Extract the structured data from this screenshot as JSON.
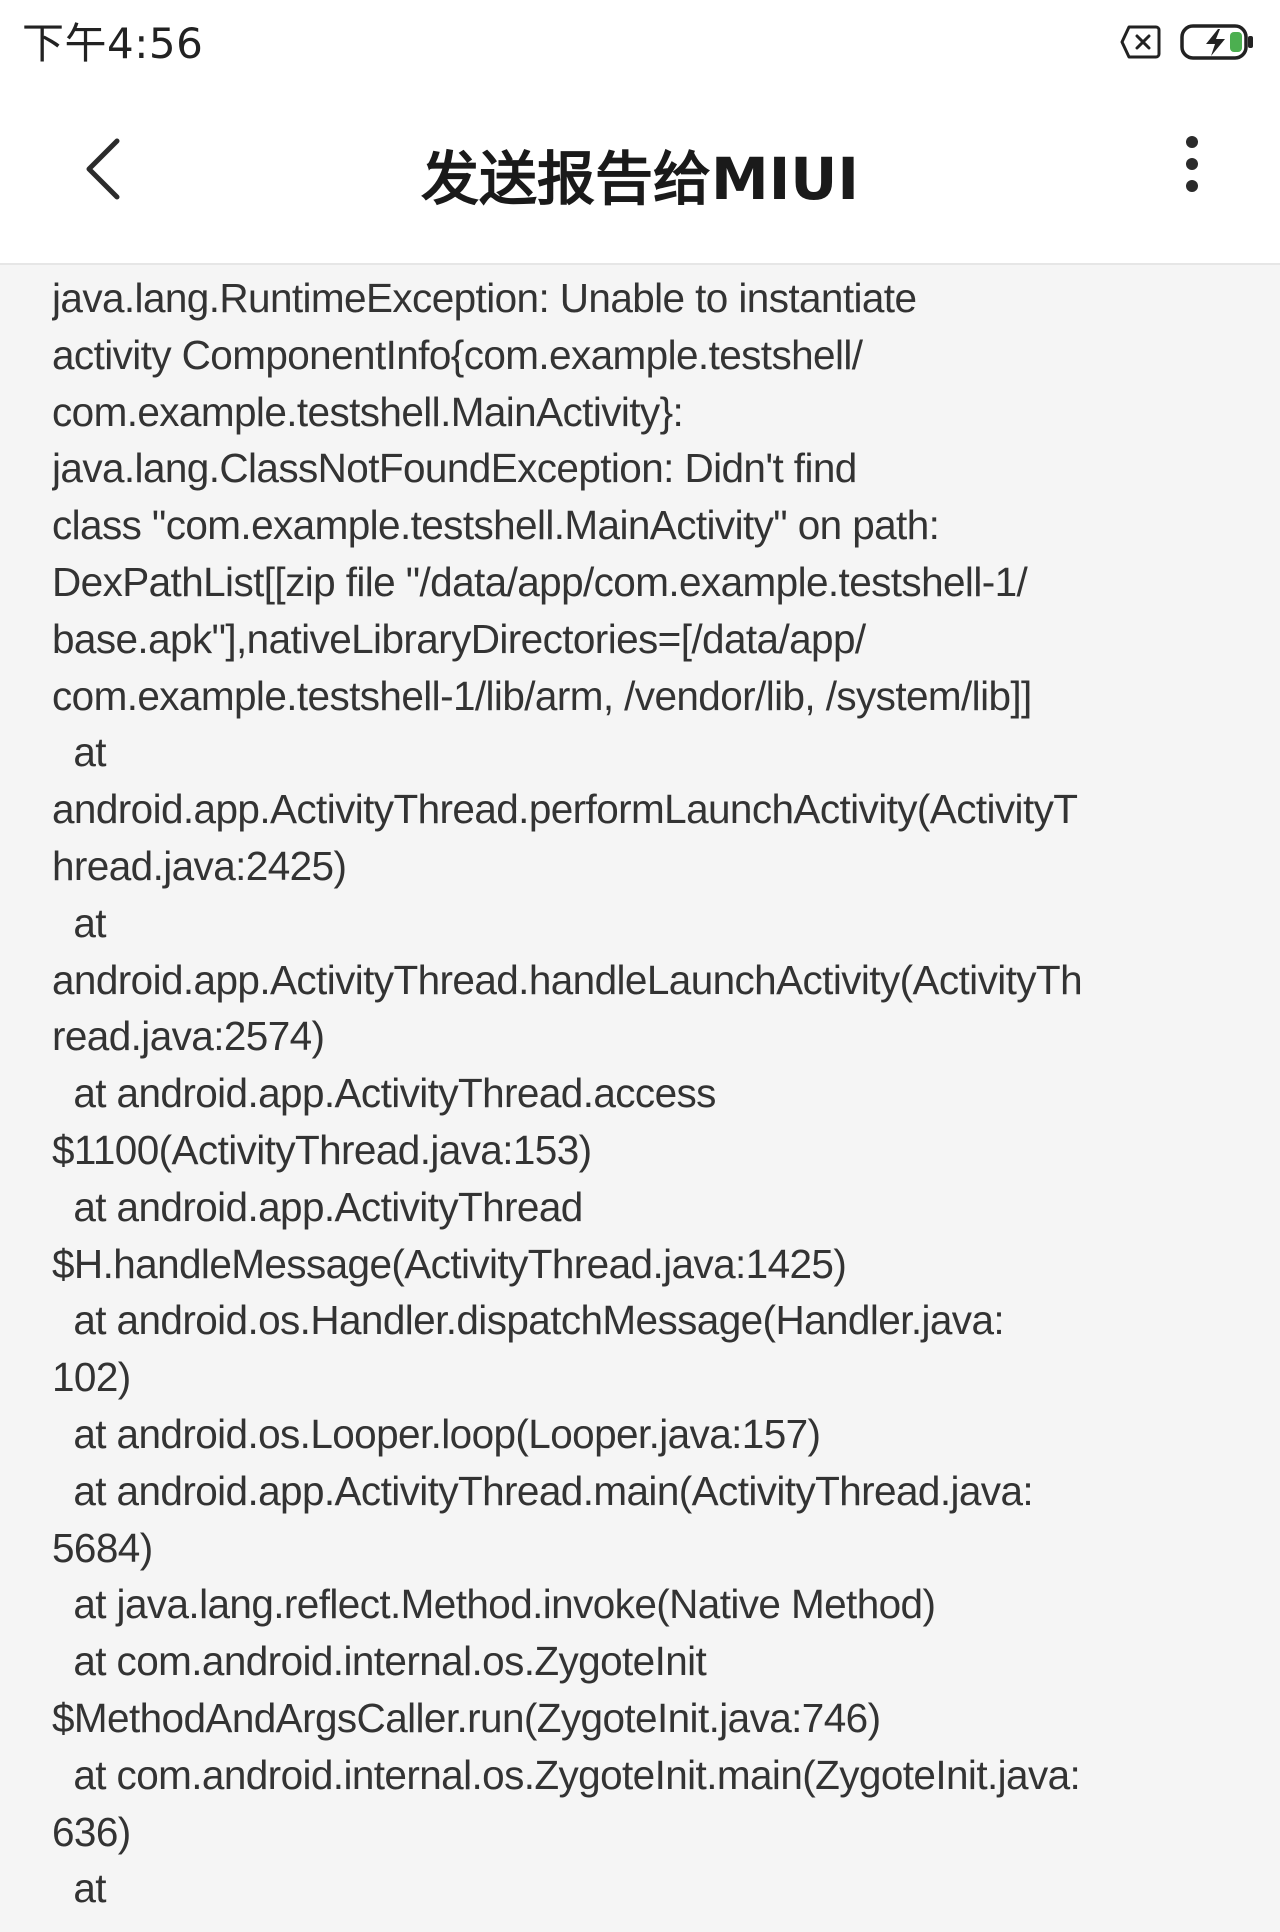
{
  "status_bar": {
    "time": "下午4:56",
    "icons": [
      "sim-card-off-icon",
      "battery-charging-icon"
    ],
    "battery_color": "#4caf50"
  },
  "app_bar": {
    "title": "发送报告给MIUI",
    "back_icon": "back-arrow-icon",
    "more_icon": "more-vert-icon"
  },
  "report": {
    "lines": [
      "java.lang.RuntimeException: Unable to instantiate",
      "activity ComponentInfo{com.example.testshell/",
      "com.example.testshell.MainActivity}:",
      "java.lang.ClassNotFoundException: Didn't find",
      "class \"com.example.testshell.MainActivity\" on path:",
      "DexPathList[[zip file \"/data/app/com.example.testshell-1/",
      "base.apk\"],nativeLibraryDirectories=[/data/app/",
      "com.example.testshell-1/lib/arm, /vendor/lib, /system/lib]]",
      "  at",
      "android.app.ActivityThread.performLaunchActivity(ActivityT",
      "hread.java:2425)",
      "  at",
      "android.app.ActivityThread.handleLaunchActivity(ActivityTh",
      "read.java:2574)",
      "  at android.app.ActivityThread.access",
      "$1100(ActivityThread.java:153)",
      "  at android.app.ActivityThread",
      "$H.handleMessage(ActivityThread.java:1425)",
      "  at android.os.Handler.dispatchMessage(Handler.java:",
      "102)",
      "  at android.os.Looper.loop(Looper.java:157)",
      "  at android.app.ActivityThread.main(ActivityThread.java:",
      "5684)",
      "  at java.lang.reflect.Method.invoke(Native Method)",
      "  at com.android.internal.os.ZygoteInit",
      "$MethodAndArgsCaller.run(ZygoteInit.java:746)",
      "  at com.android.internal.os.ZygoteInit.main(ZygoteInit.java:",
      "636)",
      "  at"
    ]
  }
}
